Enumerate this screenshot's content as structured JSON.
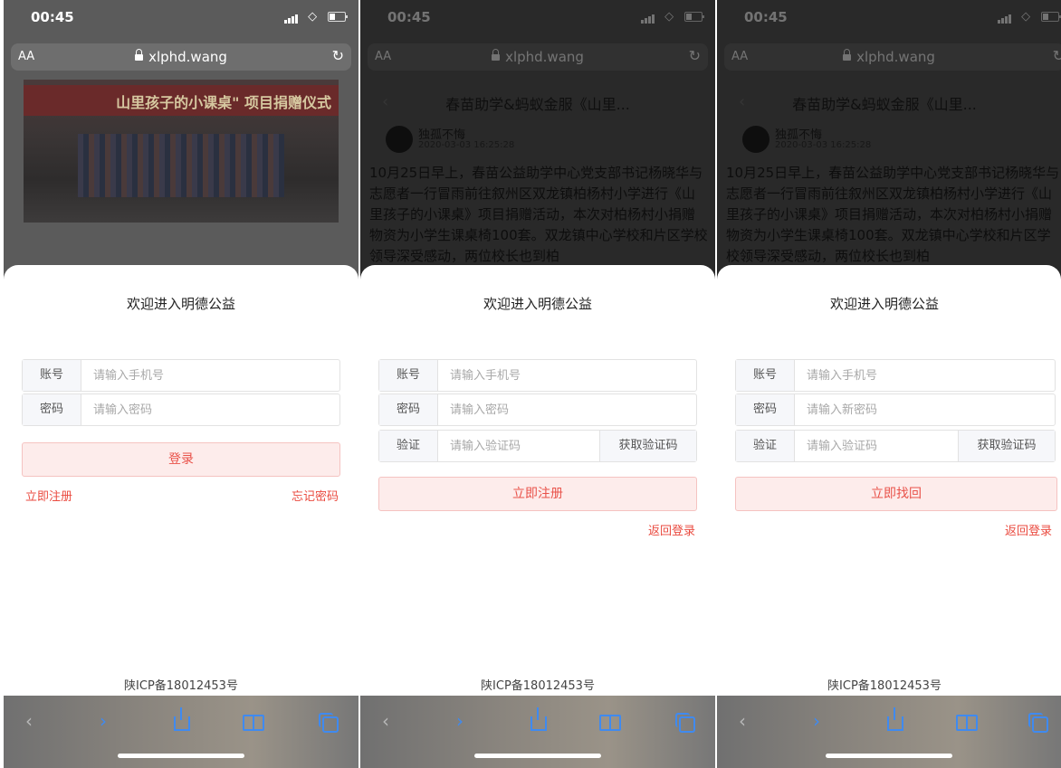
{
  "status": {
    "time": "00:45"
  },
  "browser": {
    "aa": "AA",
    "domain": "xlphd.wang",
    "reload": "↻"
  },
  "photo_banner": "山里孩子的小课桌\" 项目捐赠仪式",
  "article": {
    "back": "‹",
    "title": "春苗助学&蚂蚁金服《山里...",
    "author": "独孤不悔",
    "timestamp": "2020-03-03 16:25:28",
    "body": "10月25日早上，春苗公益助学中心党支部书记杨晓华与志愿者一行冒雨前往叙州区双龙镇柏杨村小学进行《山里孩子的小课桌》项目捐赠活动，本次对柏杨村小捐赠物资为小学生课桌椅100套。双龙镇中心学校和片区学校领导深受感动，两位校长也到柏"
  },
  "login": {
    "welcome": "欢迎进入明德公益",
    "account_label": "账号",
    "account_placeholder": "请输入手机号",
    "password_label": "密码",
    "password_placeholder": "请输入密码",
    "login_button": "登录",
    "register_link": "立即注册",
    "forgot_link": "忘记密码"
  },
  "register": {
    "welcome": "欢迎进入明德公益",
    "account_label": "账号",
    "account_placeholder": "请输入手机号",
    "password_label": "密码",
    "password_placeholder": "请输入密码",
    "verify_label": "验证",
    "verify_placeholder": "请输入验证码",
    "get_code": "获取验证码",
    "register_button": "立即注册",
    "back_login": "返回登录"
  },
  "recover": {
    "welcome": "欢迎进入明德公益",
    "account_label": "账号",
    "account_placeholder": "请输入手机号",
    "password_label": "密码",
    "password_placeholder": "请输入新密码",
    "verify_label": "验证",
    "verify_placeholder": "请输入验证码",
    "get_code": "获取验证码",
    "recover_button": "立即找回",
    "back_login": "返回登录"
  },
  "footer": {
    "icp": "陕ICP备18012453号"
  },
  "toolbar": {
    "back": "‹",
    "forward": "›"
  },
  "colors": {
    "accent": "#ea4a3f",
    "button_bg": "#fdeceb",
    "ios_blue": "#3f8af0"
  }
}
